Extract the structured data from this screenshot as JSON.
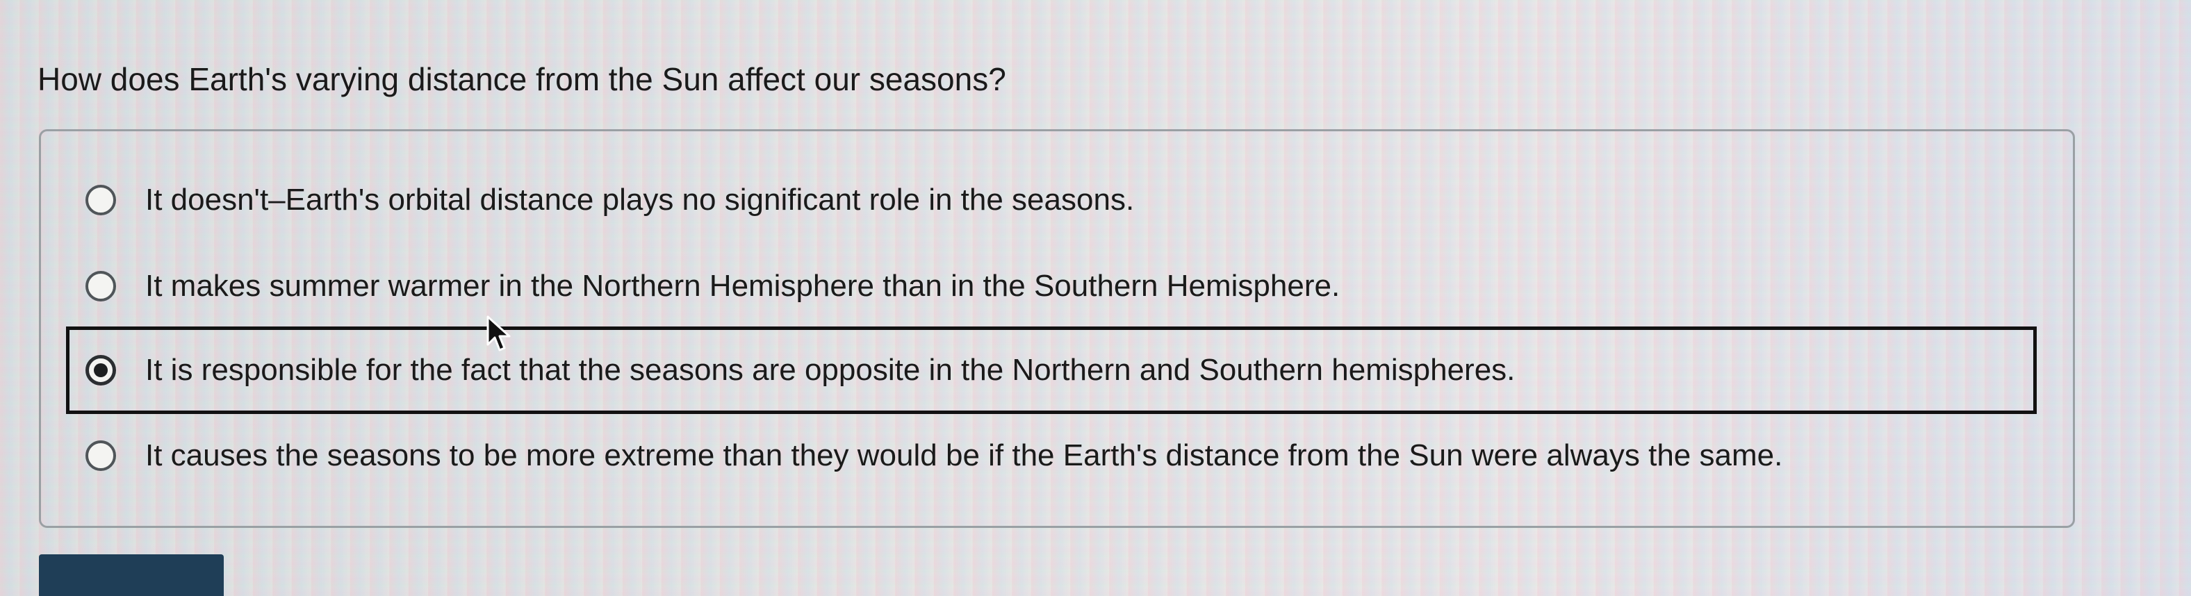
{
  "question": {
    "text": "How does Earth's varying distance from the Sun affect our seasons?"
  },
  "options": [
    {
      "label": "It doesn't–Earth's orbital distance plays no significant role in the seasons.",
      "selected": false
    },
    {
      "label": "It makes summer warmer in the Northern Hemisphere than in the Southern Hemisphere.",
      "selected": false
    },
    {
      "label": "It is responsible for the fact that the seasons are opposite in the Northern and Southern hemispheres.",
      "selected": true
    },
    {
      "label": "It causes the seasons to be more extreme than they would be if the Earth's distance from the Sun were always the same.",
      "selected": false
    }
  ],
  "colors": {
    "submit_button": "#1f3e57",
    "selected_border": "#111111"
  }
}
